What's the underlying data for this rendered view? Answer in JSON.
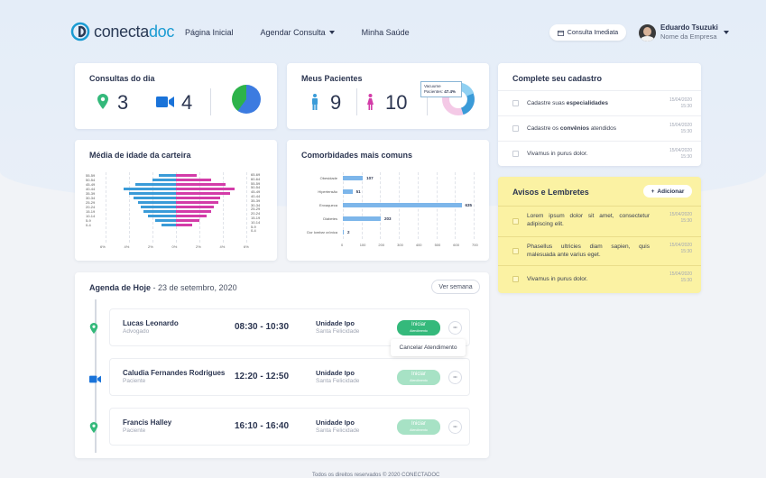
{
  "brand": {
    "logo_plain": "conecta",
    "logo_accent": "doc"
  },
  "nav": {
    "home": "Página Inicial",
    "schedule": "Agendar Consulta",
    "health": "Minha Saúde"
  },
  "header": {
    "immediate_label": "Consulta Imediata"
  },
  "user": {
    "name": "Eduardo Tsuzuki",
    "company": "Nome da Empresa"
  },
  "consultas": {
    "title": "Consultas do dia",
    "presencial": "3",
    "online": "4"
  },
  "pacientes": {
    "title": "Meus Pacientes",
    "male": "9",
    "female": "10",
    "tooltip_label": "Vacuume",
    "tooltip_label2": "Pacientes:",
    "tooltip_value": "47.4%"
  },
  "colors": {
    "accent": "#1a9bd2",
    "male": "#3a9bd8",
    "female": "#d33ca8",
    "green": "#34b97b",
    "notes": "#fbf2a3"
  },
  "idade": {
    "title": "Média de idade da carteira",
    "chart_data": {
      "type": "bar",
      "categories": [
        "55-59",
        "50-54",
        "45-49",
        "40-44",
        "35-39",
        "30-34",
        "25-29",
        "20-24",
        "15-19",
        "10-14",
        "5-9",
        "0-4"
      ],
      "categories_right": [
        "65-69",
        "60-64",
        "55-59",
        "50-54",
        "45-49",
        "40-44",
        "35-39",
        "30-34",
        "25-29",
        "20-24",
        "15-19",
        "10-14",
        "5-9",
        "0-4"
      ],
      "series": [
        {
          "name": "",
          "values": [
            1.5,
            2.0,
            3.5,
            4.5,
            4.0,
            3.6,
            3.2,
            3.0,
            2.8,
            2.4,
            1.8,
            1.2
          ]
        },
        {
          "name": "",
          "values": [
            1.8,
            3.0,
            4.2,
            5.0,
            4.6,
            3.8,
            3.6,
            3.2,
            3.0,
            2.6,
            2.0,
            1.4
          ]
        }
      ],
      "xticks": [
        "6%",
        "4%",
        "2%",
        "0%",
        "2%",
        "4%",
        "6%"
      ]
    }
  },
  "comorb": {
    "title": "Comorbidades mais comuns",
    "chart_data": {
      "type": "bar",
      "categories": [
        "Obesidade",
        "Hipertensão",
        "Enxaqueca",
        "Diabetes",
        "Dor lombar crônica"
      ],
      "values": [
        107,
        51,
        635,
        203,
        2
      ],
      "xticks": [
        "0",
        "100",
        "200",
        "300",
        "400",
        "500",
        "600",
        "700"
      ],
      "xlim": [
        0,
        700
      ]
    }
  },
  "cadastro": {
    "title": "Complete seu cadastro",
    "items": [
      {
        "pre": "Cadastre suas ",
        "bold": "especialidades",
        "post": "",
        "date": "15/04/2020",
        "time": "15:30"
      },
      {
        "pre": "Cadastre os ",
        "bold": "convênios",
        "post": " atendidos",
        "date": "15/04/2020",
        "time": "15:30"
      },
      {
        "pre": "Vivamus in purus dolor.",
        "bold": "",
        "post": "",
        "date": "15/04/2020",
        "time": "15:30"
      }
    ]
  },
  "avisos": {
    "title": "Avisos e Lembretes",
    "add_label": "Adicionar",
    "items": [
      {
        "text": "Lorem ipsum dolor sit amet, consectetur adipiscing elit.",
        "date": "15/04/2020",
        "time": "15:30"
      },
      {
        "text": "Phasellus ultricies diam sapien, quis malesuada ante varius eget.",
        "date": "15/04/2020",
        "time": "15:30"
      },
      {
        "text": "Vivamus in purus dolor.",
        "date": "15/04/2020",
        "time": "15:30"
      }
    ]
  },
  "agenda": {
    "title": "Agenda de Hoje",
    "date": " - 23 de setembro, 2020",
    "week_label": "Ver semana",
    "start_label": "Iniciar",
    "start_sub": "Atendimento",
    "cancel_label": "Cancelar Atendimento",
    "items": [
      {
        "name": "Lucas Leonardo",
        "role": "Advogado",
        "time": "08:30 - 10:30",
        "unit": "Unidade Ipo",
        "location": "Santa Felicidade"
      },
      {
        "name": "Caludia Fernandes Rodrigues",
        "role": "Paciente",
        "time": "12:20 - 12:50",
        "unit": "Unidade Ipo",
        "location": "Santa Felicidade"
      },
      {
        "name": "Francis Halley",
        "role": "Paciente",
        "time": "16:10 - 16:40",
        "unit": "Unidade Ipo",
        "location": "Santa Felicidade"
      }
    ]
  },
  "footer": {
    "text": "Todos os direitos reservados © 2020 CONECTADOC"
  }
}
